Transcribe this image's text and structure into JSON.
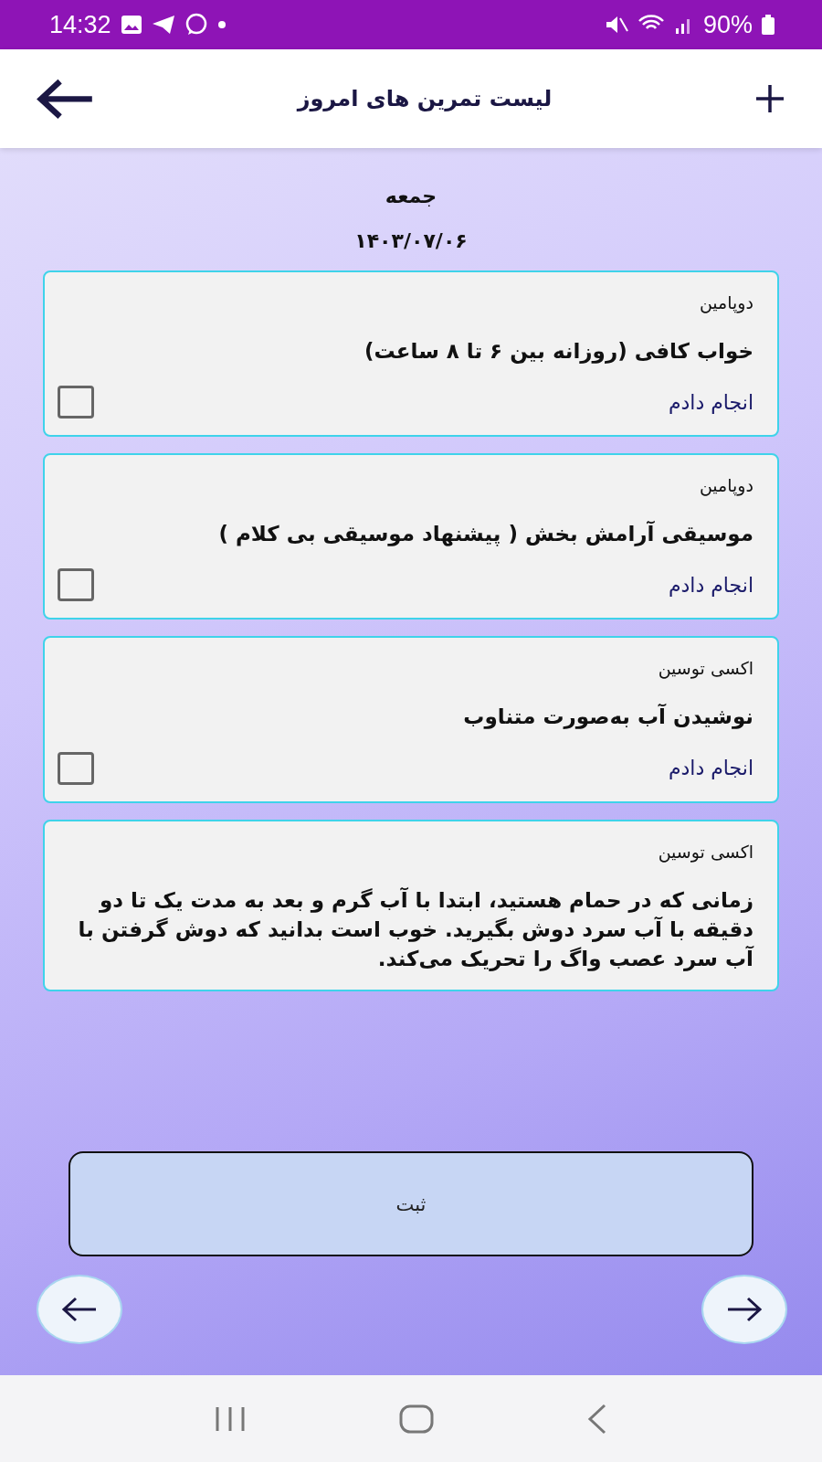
{
  "status_bar": {
    "time": "14:32",
    "battery": "90%"
  },
  "header": {
    "title": "لیست تمرین های امروز"
  },
  "day": "جمعه",
  "date": "۱۴۰۳/۰۷/۰۶",
  "cards": [
    {
      "category": "دوپامین",
      "title": "خواب کافی (روزانه بین ۶ تا ۸ ساعت)",
      "done_label": "انجام دادم",
      "checked": false
    },
    {
      "category": "دوپامین",
      "title": "موسیقی آرامش بخش ( پیشنهاد موسیقی بی کلام )",
      "done_label": "انجام دادم",
      "checked": false
    },
    {
      "category": "اکسی توسین",
      "title": "نوشیدن آب به‌صورت متناوب",
      "done_label": "انجام دادم",
      "checked": false
    },
    {
      "category": "اکسی توسین",
      "title": "زمانی که در حمام هستید، ابتدا با آب گرم و بعد به مدت یک تا دو دقیقه با آب سرد دوش بگیرید. خوب است بدانید که دوش گرفتن با آب سرد عصب واگ را تحریک می‌کند."
    }
  ],
  "submit_label": "ثبت"
}
